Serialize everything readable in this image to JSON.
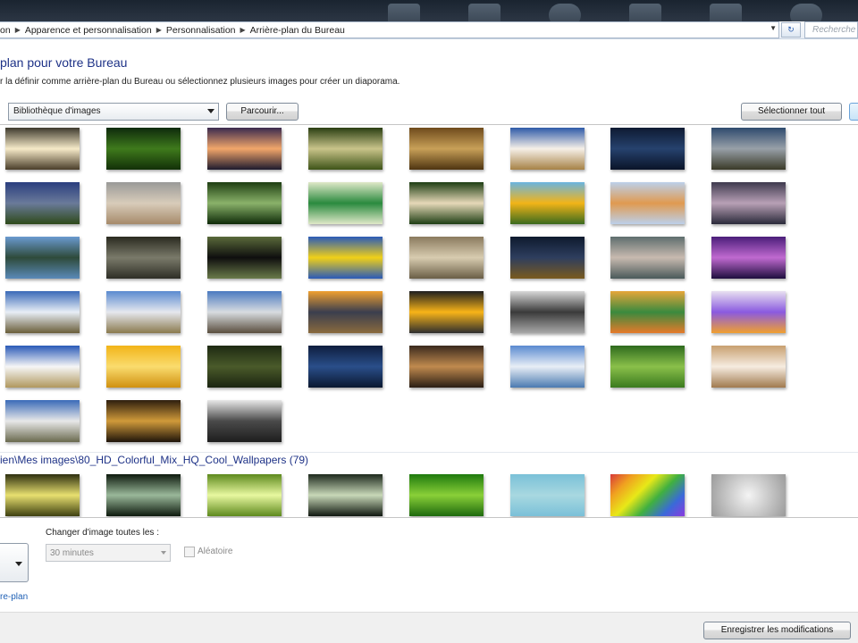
{
  "breadcrumb": {
    "items": [
      "on",
      "Apparence et personnalisation",
      "Personnalisation",
      "Arrière-plan du Bureau"
    ],
    "search_placeholder": "Recherche"
  },
  "heading": {
    "title": "plan pour votre Bureau",
    "instructions": "r la définir comme arrière-plan du Bureau ou sélectionnez plusieurs images pour créer un diaporama."
  },
  "location": {
    "selected": "Bibliothèque d'images",
    "browse_label": "Parcourir...",
    "select_all_label": "Sélectionner tout"
  },
  "group2": {
    "header": "ien\\Mes images\\80_HD_Colorful_Mix_HQ_Cool_Wallpapers (79)"
  },
  "options": {
    "interval_label": "Changer d'image toutes les :",
    "interval_value": "30 minutes",
    "shuffle_label": "Aléatoire",
    "link_label": "re-plan"
  },
  "footer": {
    "save_label": "Enregistrer les modifications"
  },
  "colors": {
    "title_blue": "#1e3287",
    "link_blue": "#1e5fb4"
  }
}
